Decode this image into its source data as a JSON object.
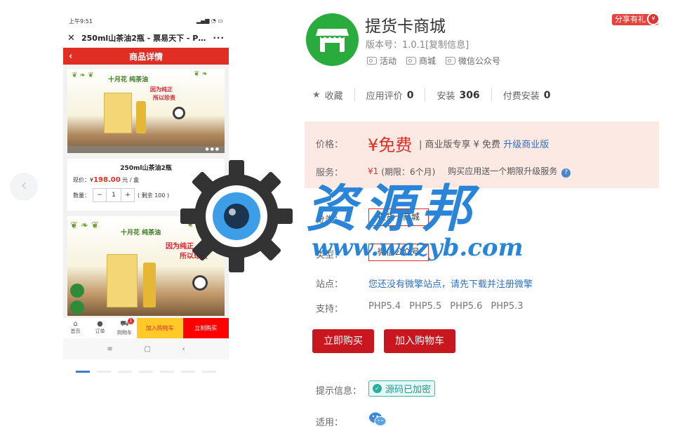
{
  "phone": {
    "status_time": "上午9:51",
    "title": "250ml山茶油2瓶 - 票易天下 - Powe...",
    "header": "商品详情",
    "banner_text": {
      "line1": "十月花 纯茶油",
      "line2": "因为纯正",
      "line3": "所以珍贵"
    },
    "product_name": "250ml山茶油2瓶",
    "price_label": "现价：¥",
    "price_value": "198.00",
    "price_unit": "元 / 盒",
    "qty_label": "数量：",
    "qty_minus": "−",
    "qty_value": "1",
    "qty_plus": "+",
    "stock": "( 剩余 100 )",
    "banner2_text": {
      "line1": "十月花 纯茶油",
      "line2": "因为纯正",
      "line3": "所以珍贵"
    },
    "tabbar": {
      "home": "首页",
      "orders": "订单",
      "cart": "购物车",
      "cart_badge": "1",
      "add_cart": "加入购物车",
      "buy_now": "立刻购买"
    },
    "nav": {
      "menu": "≡",
      "home": "▢",
      "back": "‹"
    }
  },
  "app": {
    "name": "提货卡商城",
    "share": "分享有礼",
    "version": "版本号：1.0.1[复制信息]",
    "tags": [
      "活动",
      "商城",
      "微信公众号"
    ],
    "stats": {
      "favorite_label": "收藏",
      "rating_label": "应用评价",
      "rating_value": "0",
      "installs_label": "安装",
      "installs_value": "306",
      "paid_installs_label": "付费安装",
      "paid_installs_value": "0"
    },
    "price_label": "价格：",
    "price_value": "¥免费",
    "price_extra": "| 商业版专享 ¥ 免费",
    "upgrade_link": "升级商业版",
    "service_label": "服务：",
    "service_value": "¥1",
    "service_period": "(期限：6个月)",
    "service_desc": "购买应用送一个期限升级服务",
    "category_label": "分类：",
    "category_value": "提货卡商城",
    "type_label": "类型：",
    "type_value": "微信公众号",
    "site_label": "站点：",
    "site_link": "您还没有微擎站点，请先下载并注册微擎",
    "support_label": "支持：",
    "support_versions": [
      "PHP5.4",
      "PHP5.5",
      "PHP5.6",
      "PHP5.3"
    ],
    "buy_button": "立即购买",
    "cart_button": "加入购物车",
    "hint_label": "提示信息：",
    "hint_value": "源码已加密",
    "apply_label": "适用："
  },
  "watermark": {
    "text": "资源邦",
    "url": "www.wazyb.com"
  },
  "colors": {
    "accent_red": "#c8171e",
    "price_red": "#e02e24",
    "link_blue": "#2f6fbf",
    "app_icon_green": "#2aab3d",
    "watermark_blue": "#1f7fd6"
  }
}
